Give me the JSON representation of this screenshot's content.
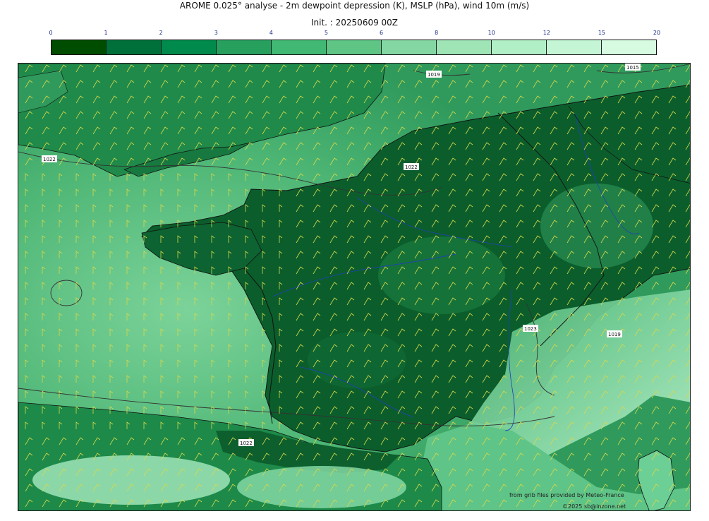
{
  "header": {
    "title": "AROME 0.025° analyse - 2m dewpoint depression (K), MSLP (hPa), wind 10m (m/s)",
    "init": "Init. : 20250609 00Z"
  },
  "colorbar": {
    "ticks": [
      "0",
      "1",
      "2",
      "3",
      "4",
      "5",
      "6",
      "8",
      "10",
      "12",
      "15",
      "20"
    ],
    "colors": [
      "#004d00",
      "#00703a",
      "#008a4b",
      "#27a05e",
      "#41b873",
      "#5ec585",
      "#84d7a3",
      "#9ee4b5",
      "#b1efc6",
      "#c4f6d5",
      "#d6fbe1"
    ]
  },
  "map": {
    "land_dark": "#0b5e2c",
    "sea_color": "#3ea969",
    "isobar_labels": [
      "1019",
      "1015",
      "1022",
      "1022",
      "1023",
      "1022",
      "1019"
    ]
  },
  "credits": {
    "source": "from grib files provided by Meteo-France",
    "copyright": "©2025 sb@inzone.net"
  }
}
